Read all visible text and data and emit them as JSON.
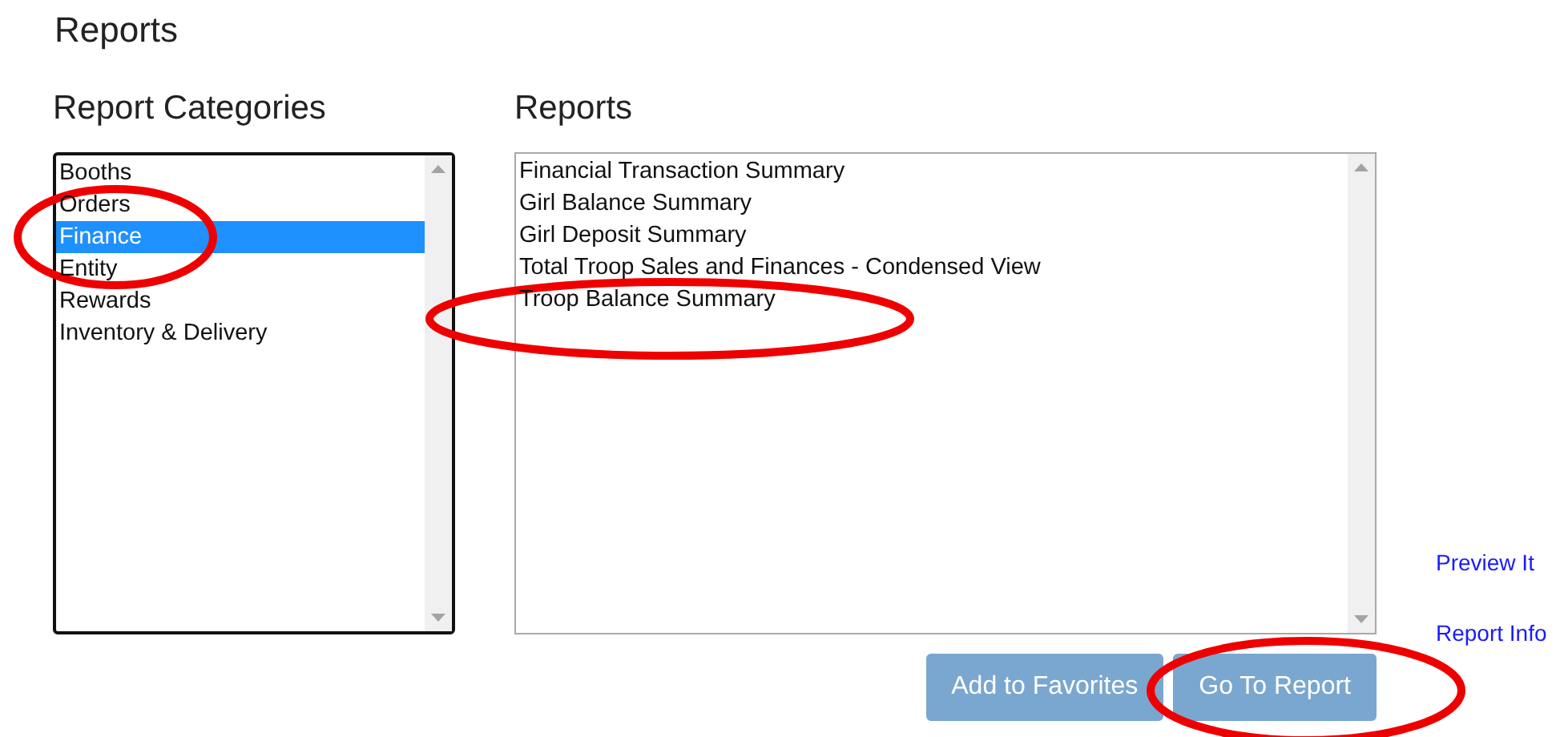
{
  "page_title": "Reports",
  "categories": {
    "heading": "Report Categories",
    "items": [
      {
        "label": "Booths",
        "selected": false
      },
      {
        "label": "Orders",
        "selected": false
      },
      {
        "label": "Finance",
        "selected": true
      },
      {
        "label": "Entity",
        "selected": false
      },
      {
        "label": "Rewards",
        "selected": false
      },
      {
        "label": "Inventory & Delivery",
        "selected": false
      }
    ]
  },
  "reports": {
    "heading": "Reports",
    "items": [
      {
        "label": "Financial Transaction Summary",
        "selected": false
      },
      {
        "label": "Girl Balance Summary",
        "selected": false
      },
      {
        "label": "Girl Deposit Summary",
        "selected": false
      },
      {
        "label": "Total Troop Sales and Finances - Condensed View",
        "selected": false
      },
      {
        "label": "Troop Balance Summary",
        "selected": false
      }
    ]
  },
  "buttons": [
    "Add to Favorites",
    "Go To Report"
  ],
  "links": [
    "Preview It",
    "Report Info"
  ]
}
